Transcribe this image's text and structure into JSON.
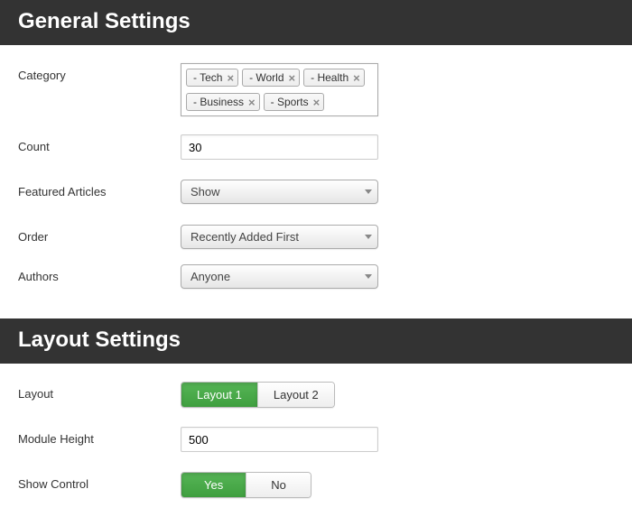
{
  "sections": {
    "general": {
      "title": "General Settings",
      "fields": {
        "category": {
          "label": "Category",
          "tags": [
            "- Tech",
            "- World",
            "- Health",
            "- Business",
            "- Sports"
          ]
        },
        "count": {
          "label": "Count",
          "value": "30"
        },
        "featured": {
          "label": "Featured Articles",
          "value": "Show"
        },
        "order": {
          "label": "Order",
          "value": "Recently Added First"
        },
        "authors": {
          "label": "Authors",
          "value": "Anyone"
        }
      }
    },
    "layout": {
      "title": "Layout Settings",
      "fields": {
        "layout": {
          "label": "Layout",
          "options": [
            "Layout 1",
            "Layout 2"
          ],
          "active": 0
        },
        "moduleHeight": {
          "label": "Module Height",
          "value": "500"
        },
        "showControl": {
          "label": "Show Control",
          "options": [
            "Yes",
            "No"
          ],
          "active": 0
        }
      }
    }
  }
}
